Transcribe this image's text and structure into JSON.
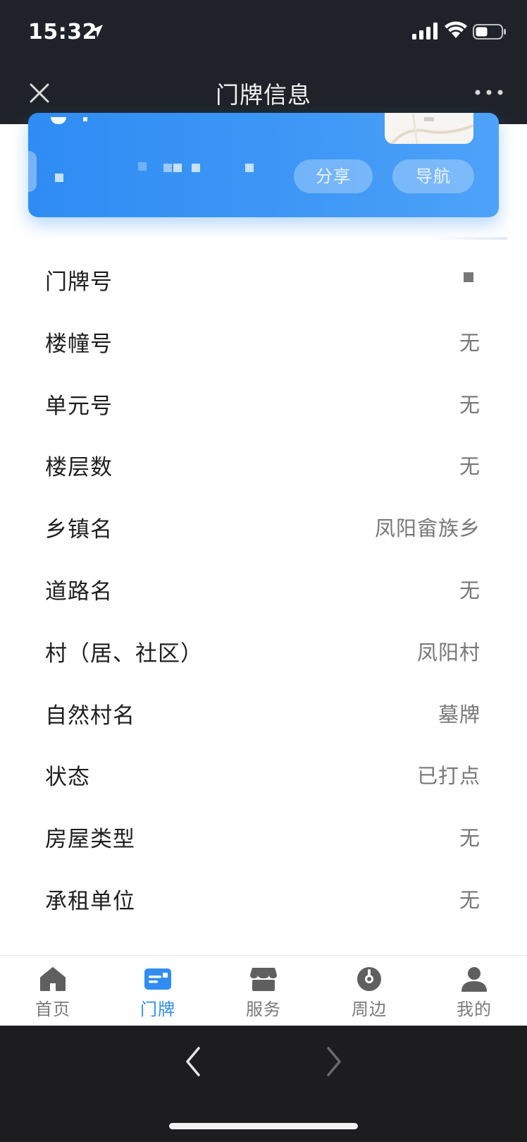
{
  "status_bar": {
    "time": "15:32",
    "icons": [
      "location-arrow-icon",
      "signal-icon",
      "wifi-icon",
      "battery-icon"
    ]
  },
  "header": {
    "title": "门牌信息",
    "close_icon": "close-icon",
    "more_icon": "more-icon"
  },
  "card": {
    "share_label": "分享",
    "navigate_label": "导航",
    "accent_color": "#2f8cf3"
  },
  "details": [
    {
      "label": "门牌号",
      "value": ""
    },
    {
      "label": "楼幢号",
      "value": "无"
    },
    {
      "label": "单元号",
      "value": "无"
    },
    {
      "label": "楼层数",
      "value": "无"
    },
    {
      "label": "乡镇名",
      "value": "凤阳畲族乡"
    },
    {
      "label": "道路名",
      "value": "无"
    },
    {
      "label": "村（居、社区）",
      "value": "凤阳村"
    },
    {
      "label": "自然村名",
      "value": "墓牌"
    },
    {
      "label": "状态",
      "value": "已打点"
    },
    {
      "label": "房屋类型",
      "value": "无"
    },
    {
      "label": "承租单位",
      "value": "无"
    }
  ],
  "tabbar": {
    "items": [
      {
        "label": "首页",
        "icon": "home-icon",
        "active": false
      },
      {
        "label": "门牌",
        "icon": "doorplate-icon",
        "active": true
      },
      {
        "label": "服务",
        "icon": "shop-icon",
        "active": false
      },
      {
        "label": "周边",
        "icon": "compass-icon",
        "active": false
      },
      {
        "label": "我的",
        "icon": "user-icon",
        "active": false
      }
    ],
    "active_color": "#2f8cf3",
    "inactive_color": "#7a7a7a"
  },
  "browser_bar": {
    "back_icon": "chevron-left-icon",
    "forward_icon": "chevron-right-icon"
  }
}
